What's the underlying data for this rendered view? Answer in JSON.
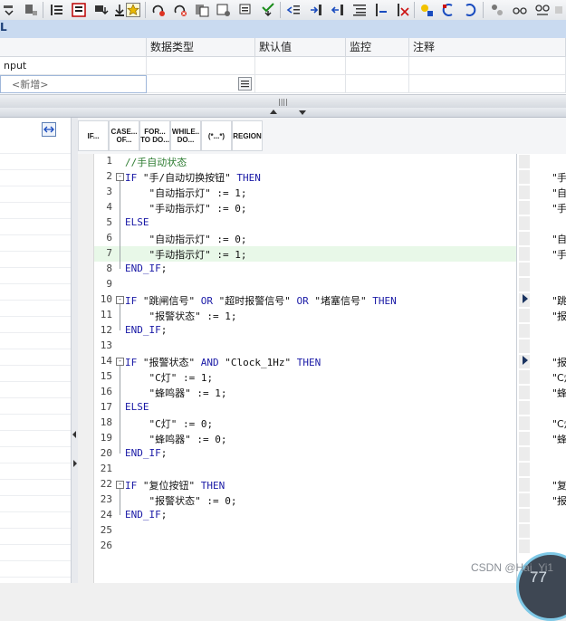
{
  "bluebar": {
    "text": "L"
  },
  "interface_table": {
    "columns": [
      "",
      "数据类型",
      "默认值",
      "监控",
      "注释"
    ],
    "row1_name": "nput",
    "row2_name": "<新增>"
  },
  "instructions": [
    {
      "label": "IF..."
    },
    {
      "label": "CASE... OF..."
    },
    {
      "label": "FOR... TO DO..."
    },
    {
      "label": "WHILE.. DO..."
    },
    {
      "label": "(*...*)"
    },
    {
      "label": "REGION"
    }
  ],
  "code_lines": [
    {
      "num": "1",
      "text": "//手自动状态"
    },
    {
      "num": "2",
      "text": "IF \"手/自动切换按钮\" THEN"
    },
    {
      "num": "3",
      "text": "    \"自动指示灯\" := 1;"
    },
    {
      "num": "4",
      "text": "    \"手动指示灯\" := 0;"
    },
    {
      "num": "5",
      "text": "ELSE"
    },
    {
      "num": "6",
      "text": "    \"自动指示灯\" := 0;"
    },
    {
      "num": "7",
      "text": "    \"手动指示灯\" := 1;"
    },
    {
      "num": "8",
      "text": "END_IF;"
    },
    {
      "num": "9",
      "text": ""
    },
    {
      "num": "10",
      "text": "IF \"跳闸信号\" OR \"超时报警信号\" OR \"堵塞信号\" THEN"
    },
    {
      "num": "11",
      "text": "    \"报警状态\" := 1;"
    },
    {
      "num": "12",
      "text": "END_IF;"
    },
    {
      "num": "13",
      "text": ""
    },
    {
      "num": "14",
      "text": "IF \"报警状态\" AND \"Clock_1Hz\" THEN"
    },
    {
      "num": "15",
      "text": "    \"C灯\" := 1;"
    },
    {
      "num": "16",
      "text": "    \"蜂鸣器\" := 1;"
    },
    {
      "num": "17",
      "text": "ELSE"
    },
    {
      "num": "18",
      "text": "    \"C灯\" := 0;"
    },
    {
      "num": "19",
      "text": "    \"蜂鸣器\" := 0;"
    },
    {
      "num": "20",
      "text": "END_IF;"
    },
    {
      "num": "21",
      "text": ""
    },
    {
      "num": "22",
      "text": "IF \"复位按钮\" THEN"
    },
    {
      "num": "23",
      "text": "    \"报警状态\" := 0;"
    },
    {
      "num": "24",
      "text": "END_IF;"
    },
    {
      "num": "25",
      "text": ""
    },
    {
      "num": "26",
      "text": ""
    }
  ],
  "right_panel": [
    {
      "text": "\"手"
    },
    {
      "text": "\"自"
    },
    {
      "text": "\"手"
    },
    {
      "text": "\"自"
    },
    {
      "text": "\"手"
    },
    {
      "text": "\"跳"
    },
    {
      "text": "\"报"
    },
    {
      "text": "\"报"
    },
    {
      "text": "\"C灯"
    },
    {
      "text": "\"蜂"
    },
    {
      "text": "\"C灯"
    },
    {
      "text": "\"蜂"
    },
    {
      "text": "\"复"
    },
    {
      "text": "\"报"
    }
  ],
  "watermark": "CSDN @Hai_Yi1",
  "badge": "77",
  "colors": {
    "keyword": "#1a1aa6",
    "comment": "#2e7d32",
    "highlight_line": "#e8f8e8",
    "accent": "#c9daf0"
  }
}
